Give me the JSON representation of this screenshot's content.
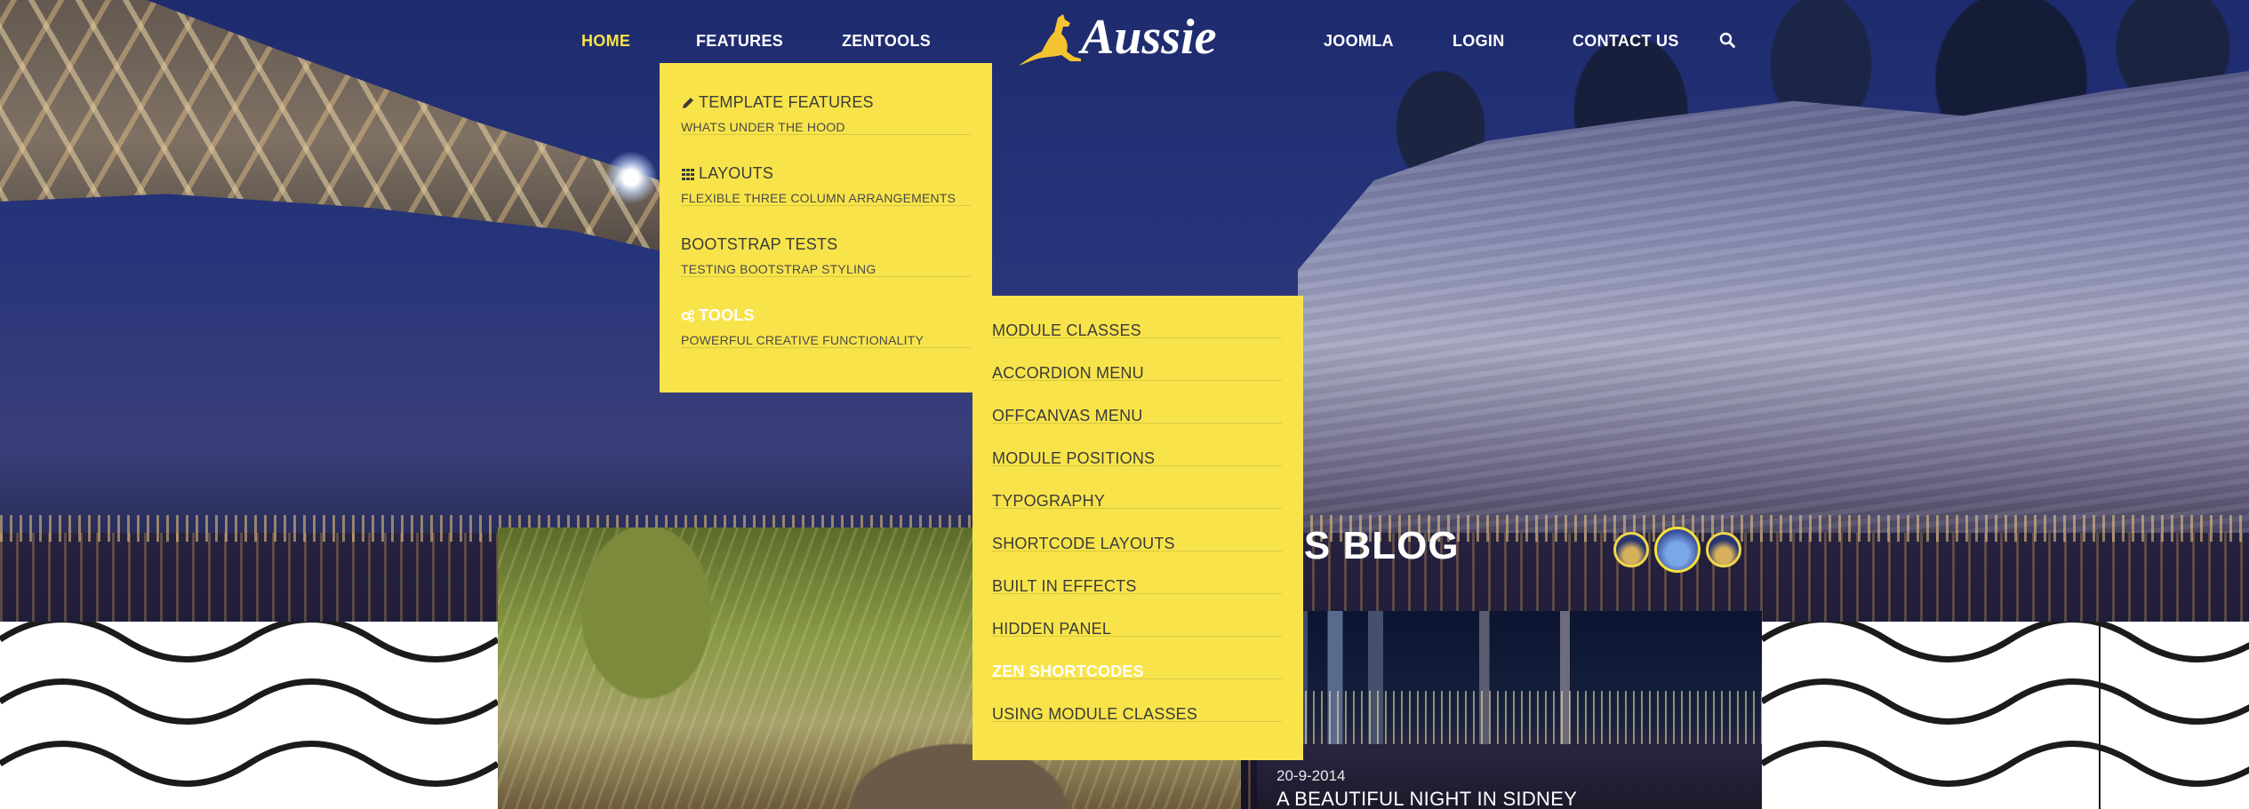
{
  "nav": {
    "items_left": [
      {
        "label": "HOME",
        "active": true
      },
      {
        "label": "FEATURES"
      },
      {
        "label": "ZENTOOLS"
      }
    ],
    "logo_text": "Aussie",
    "items_right": [
      {
        "label": "JOOMLA"
      },
      {
        "label": "LOGIN"
      },
      {
        "label": "CONTACT US"
      }
    ],
    "search_icon": "search-icon"
  },
  "features_menu": [
    {
      "icon": "pencil-icon",
      "title": "TEMPLATE FEATURES",
      "subtitle": "WHATS UNDER THE HOOD"
    },
    {
      "icon": "grid-icon",
      "title": "LAYOUTS",
      "subtitle": "FLEXIBLE THREE COLUMN ARRANGEMENTS"
    },
    {
      "icon": "",
      "title": "BOOTSTRAP TESTS",
      "subtitle": "TESTING BOOTSTRAP STYLING"
    },
    {
      "icon": "gears-icon",
      "title": "TOOLS",
      "subtitle": "POWERFUL CREATIVE FUNCTIONALITY",
      "highlight": true
    }
  ],
  "tools_submenu": [
    {
      "label": "MODULE CLASSES"
    },
    {
      "label": "ACCORDION MENU"
    },
    {
      "label": "OFFCANVAS MENU"
    },
    {
      "label": "MODULE POSITIONS"
    },
    {
      "label": "TYPOGRAPHY"
    },
    {
      "label": "SHORTCODE LAYOUTS"
    },
    {
      "label": "BUILT IN EFFECTS"
    },
    {
      "label": "HIDDEN PANEL"
    },
    {
      "label": "ZEN SHORTCODES",
      "highlight": true
    },
    {
      "label": "USING MODULE CLASSES"
    }
  ],
  "news": {
    "heading_visible": "EWS BLOG",
    "date": "20-9-2014",
    "article_title": "A BEAUTIFUL NIGHT IN SIDNEY"
  },
  "colors": {
    "accent": "#f8e44a",
    "active_nav": "#f6e24a",
    "nav_text": "#ffffff"
  }
}
